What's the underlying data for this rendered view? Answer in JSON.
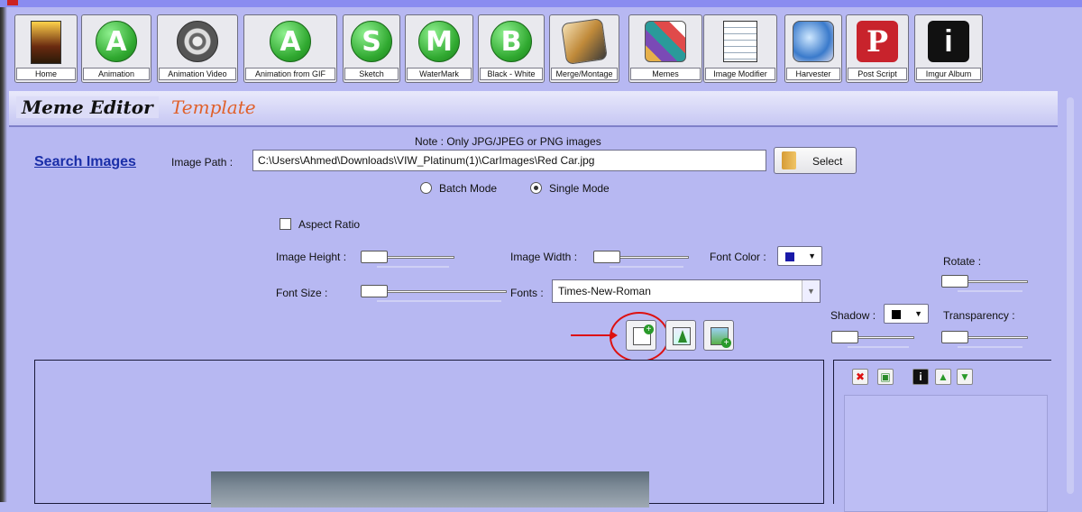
{
  "toolbar": {
    "items": [
      {
        "label": "Home",
        "icon": "home-poster-icon"
      },
      {
        "label": "Animation",
        "icon": "A-bubble-icon",
        "glyph": "A"
      },
      {
        "label": "Animation Video",
        "icon": "film-reel-icon"
      },
      {
        "label": "Animation from GIF",
        "icon": "A-bubble-icon",
        "glyph": "A"
      },
      {
        "label": "Sketch",
        "icon": "S-bubble-icon",
        "glyph": "S"
      },
      {
        "label": "WaterMark",
        "icon": "M-bubble-icon",
        "glyph": "M"
      },
      {
        "label": "Black - White",
        "icon": "B-bubble-icon",
        "glyph": "B"
      },
      {
        "label": "Merge/Montage",
        "icon": "merge-montage-icon"
      },
      {
        "label": "Memes",
        "icon": "paint-brushes-icon"
      },
      {
        "label": "Image Modifier",
        "icon": "notepad-pen-icon"
      },
      {
        "label": "Harvester",
        "icon": "harvester-globe-icon"
      },
      {
        "label": "Post Script",
        "icon": "pinterest-icon",
        "glyph": "P"
      },
      {
        "label": "Imgur Album",
        "icon": "info-i-icon",
        "glyph": "i"
      }
    ]
  },
  "tabs": {
    "active": "Meme Editor",
    "other": "Template"
  },
  "note": "Note : Only JPG/JPEG or PNG images",
  "search_link": "Search Images",
  "image_path": {
    "label": "Image Path :",
    "value": "C:\\Users\\Ahmed\\Downloads\\VIW_Platinum(1)\\CarImages\\Red Car.jpg",
    "button": "Select"
  },
  "modes": {
    "batch": "Batch Mode",
    "single": "Single Mode",
    "selected": "single"
  },
  "aspect_ratio": "Aspect Ratio",
  "controls": {
    "image_height": "Image Height :",
    "image_width": "Image Width :",
    "font_color": "Font Color :",
    "font_color_value": "#1a1aa8",
    "font_size": "Font Size :",
    "fonts": "Fonts :",
    "font_value": "Times-New-Roman",
    "rotate": "Rotate :",
    "shadow": "Shadow :",
    "shadow_color_value": "#000000",
    "transparency": "Transparency :"
  },
  "colors": {
    "background": "#b7b8f2",
    "accent_red": "#d11111",
    "link": "#1a2ea8",
    "template_tab": "#e0602a"
  }
}
